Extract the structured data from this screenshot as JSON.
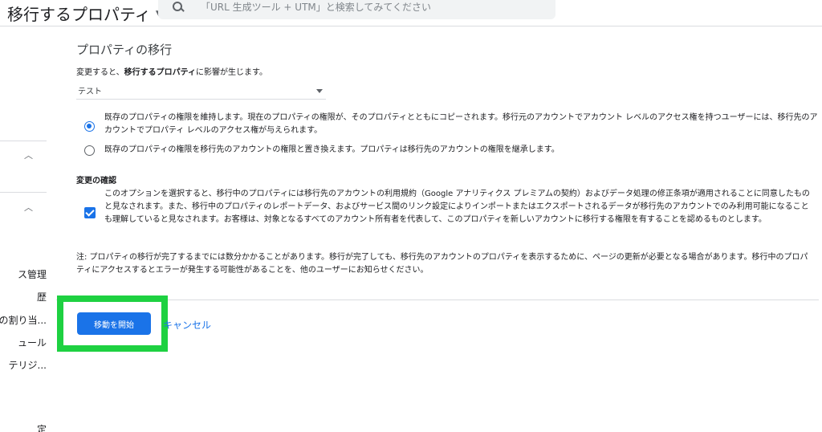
{
  "header": {
    "title": "移行するプロパティ",
    "search_placeholder": "「URL 生成ツール + UTM」と検索してみてください"
  },
  "sidebar": {
    "items": [
      {
        "label": "ス管理"
      },
      {
        "label": "歴"
      },
      {
        "label": "の割り当..."
      },
      {
        "label": "ュール"
      },
      {
        "label": "テリジ..."
      },
      {
        "label": "定"
      }
    ]
  },
  "main": {
    "title": "プロパティの移行",
    "subtitle_prefix": "変更すると、",
    "subtitle_bold": "移行するプロパティ",
    "subtitle_suffix": "に影響が生じます。",
    "select_value": "テスト",
    "option1": "既存のプロパティの権限を維持します。現在のプロパティの権限が、そのプロパティとともにコピーされます。移行元のアカウントでアカウント レベルのアクセス権を持つユーザーには、移行先のアカウントでプロパティ レベルのアクセス権が与えられます。",
    "option2": "既存のプロパティの権限を移行先のアカウントの権限と置き換えます。プロパティは移行先のアカウントの権限を継承します。",
    "confirm_label": "変更の確認",
    "confirm_text": "このオプションを選択すると、移行中のプロパティには移行先のアカウントの利用規約（Google アナリティクス プレミアムの契約）およびデータ処理の修正条項が適用されることに同意したものと見なされます。また、移行中のプロパティのレポートデータ、およびサービス間のリンク設定によりインポートまたはエクスポートされるデータが移行先のアカウントでのみ利用可能になることも理解していると見なされます。お客様は、対象となるすべてのアカウント所有者を代表して、このプロパティを新しいアカウントに移行する権限を有することを認めるものとします。",
    "note": "注: プロパティの移行が完了するまでには数分かかることがあります。移行が完了しても、移行先のアカウントのプロパティを表示するために、ページの更新が必要となる場合があります。移行中のプロパティにアクセスするとエラーが発生する可能性があることを、他のユーザーにお知らせください。"
  },
  "actions": {
    "start_label": "移動を開始",
    "cancel_label": "キャンセル"
  },
  "colors": {
    "accent": "#1a73e8",
    "highlight": "#1ed141"
  }
}
